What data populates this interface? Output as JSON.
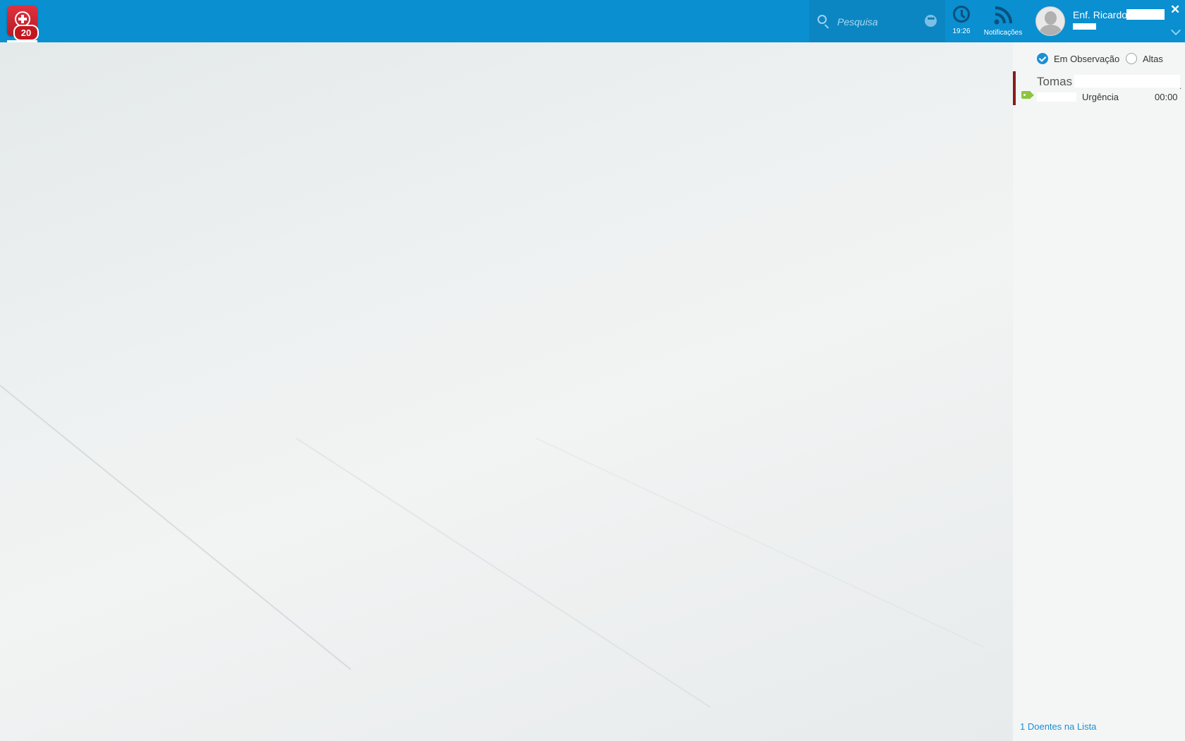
{
  "header": {
    "app_badge_count": "20",
    "search": {
      "placeholder": "Pesquisa",
      "more_label": "•••"
    },
    "clock": {
      "time": "19:26"
    },
    "notifications": {
      "label": "Notificações"
    },
    "user": {
      "name": "Enf. Ricardo"
    },
    "close_label": "✕"
  },
  "sidebar": {
    "filters": [
      {
        "label": "Em Observação",
        "checked": true
      },
      {
        "label": "Altas",
        "checked": false
      }
    ],
    "patients": [
      {
        "name": "Tomas",
        "origin": "Urgência",
        "time": "00:00",
        "tag_color": "#8cc63f",
        "priority_color": "#8a1b1e"
      }
    ],
    "count_label": "1 Doentes na Lista"
  },
  "colors": {
    "header_bg": "#0a8fd0",
    "accent": "#1c8fd4",
    "logo": "#d42531"
  }
}
